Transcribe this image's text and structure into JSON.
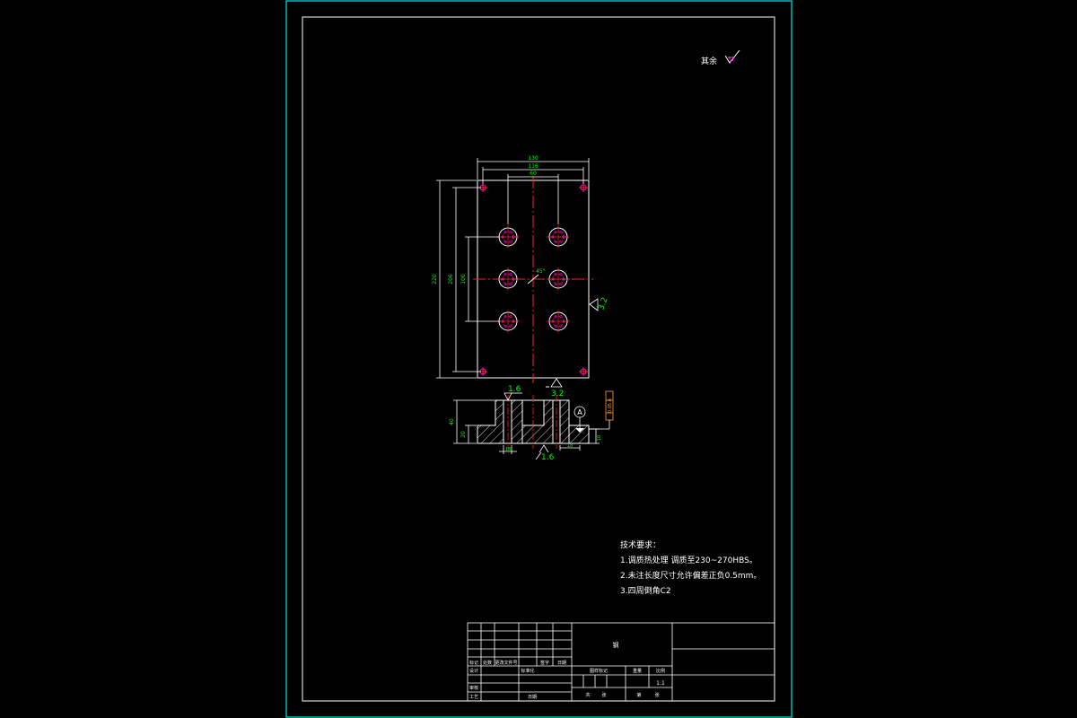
{
  "drawing": {
    "roughness_note": "其余",
    "roughness_symbol": "roughness-check-icon",
    "dims_top": [
      "130",
      "116",
      "60"
    ],
    "dims_left": [
      "220",
      "206",
      "100"
    ],
    "dim_center_angle": "45°",
    "roughness_right": "3.2",
    "roughness_bottom_plan": "3.2",
    "roughness_section_top": "1.6",
    "roughness_section_bottom": "1.6",
    "datum_label": "A",
    "tolerance_frame": "0.05 A",
    "section_dims": [
      "40",
      "20",
      "18",
      "18",
      "10"
    ]
  },
  "tech_requirements": {
    "title": "技术要求：",
    "items": [
      "1.调质热处理 调质至230~270HBS。",
      "2.未注长度尺寸允许偏差正负0.5mm。",
      "3.四周倒角C2"
    ]
  },
  "title_block": {
    "material": "钢",
    "sign_row": [
      "标记",
      "处数",
      "更改文件号",
      "签字",
      "日期"
    ],
    "design_row": [
      "设计",
      "",
      "标准化",
      "",
      ""
    ],
    "review_label": "审核",
    "process_label": "工艺",
    "date_label": "日期",
    "stage_headers": [
      "图样标记",
      "重量",
      "比例"
    ],
    "scale": "1:1",
    "sheet_labels": [
      "共",
      "张",
      "第",
      "张"
    ]
  },
  "colors": {
    "frame": "#00e5e5",
    "white": "#ffffff",
    "green": "#00ff00",
    "red": "#ff2020",
    "magenta": "#ff00ff",
    "orange": "#ff9933"
  }
}
